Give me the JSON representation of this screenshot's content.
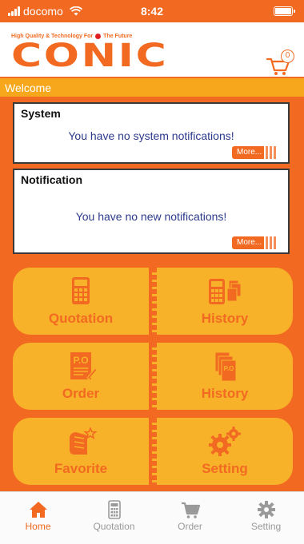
{
  "status_bar": {
    "carrier": "docomo",
    "time": "8:42",
    "battery_level": 1.0
  },
  "header": {
    "tagline_left": "High Quality & Technology For",
    "tagline_right": "The Future",
    "logo": "CONIC",
    "cart_count": "0"
  },
  "welcome": "Welcome",
  "panels": {
    "system": {
      "title": "System",
      "message": "You have no system notifications!",
      "more": "More..."
    },
    "notification": {
      "title": "Notification",
      "message": "You have no new notifications!",
      "more": "More..."
    }
  },
  "menu": [
    {
      "label": "Quotation",
      "icon": "calculator-icon"
    },
    {
      "label": "History",
      "icon": "quotation-history-icon"
    },
    {
      "label": "Order",
      "icon": "purchase-order-icon"
    },
    {
      "label": "History",
      "icon": "order-history-icon"
    },
    {
      "label": "Favorite",
      "icon": "favorite-star-icon"
    },
    {
      "label": "Setting",
      "icon": "gears-icon"
    }
  ],
  "tabs": [
    {
      "label": "Home",
      "icon": "home-icon",
      "active": true
    },
    {
      "label": "Quotation",
      "icon": "calculator-icon",
      "active": false
    },
    {
      "label": "Order",
      "icon": "cart-icon",
      "active": false
    },
    {
      "label": "Setting",
      "icon": "gear-icon",
      "active": false
    }
  ],
  "colors": {
    "brand_orange": "#F26A21",
    "button_yellow": "#F7B22A",
    "welcome_bar": "#F7A71C",
    "message_blue": "#2b3a8c"
  }
}
